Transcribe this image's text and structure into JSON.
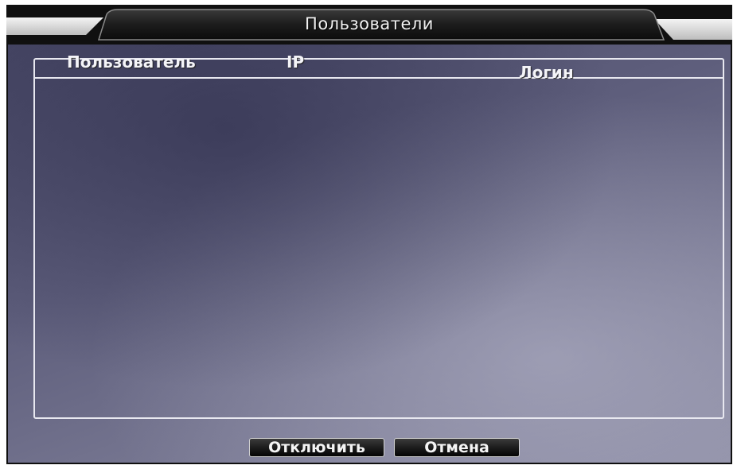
{
  "window": {
    "title": "Пользователи"
  },
  "user_table": {
    "columns": [
      {
        "label": "Пользователь"
      },
      {
        "label": "IP"
      },
      {
        "label": "Логин"
      }
    ],
    "rows": []
  },
  "buttons": {
    "disconnect_label": "Отключить",
    "cancel_label": "Отмена"
  },
  "colors": {
    "window_frame": "#101010",
    "title_text": "#f2f2f2",
    "content_background": "#5e5e7c",
    "table_border": "#e8e8f0",
    "button_background": "#1a1a1a"
  }
}
